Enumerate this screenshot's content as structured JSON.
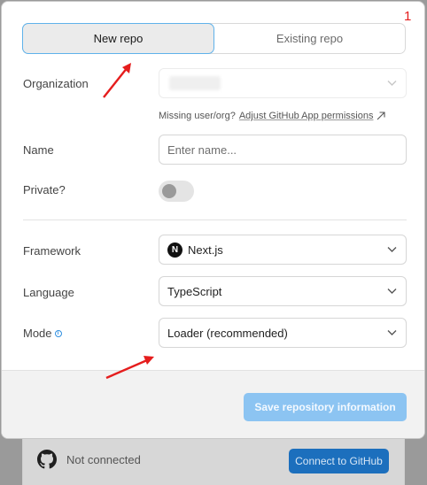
{
  "annotation": {
    "marker": "1"
  },
  "tabs": [
    {
      "label": "New repo",
      "active": true
    },
    {
      "label": "Existing repo",
      "active": false
    }
  ],
  "form": {
    "organization": {
      "label": "Organization"
    },
    "hint": {
      "text": "Missing user/org?",
      "link": "Adjust GitHub App permissions"
    },
    "name": {
      "label": "Name",
      "placeholder": "Enter name..."
    },
    "private": {
      "label": "Private?",
      "value": false
    },
    "framework": {
      "label": "Framework",
      "value": "Next.js",
      "icon": "nextjs-logo-icon",
      "icon_letter": "N"
    },
    "language": {
      "label": "Language",
      "value": "TypeScript"
    },
    "mode": {
      "label": "Mode",
      "value": "Loader (recommended)"
    }
  },
  "footer": {
    "save_label": "Save repository information"
  },
  "background": {
    "status": "Not connected",
    "connect_label": "Connect to GitHub"
  },
  "colors": {
    "accent": "#5fb2ea",
    "save_button": "#8cc4f2",
    "connect_button": "#1c6fbd",
    "arrow": "#e51d1d"
  }
}
